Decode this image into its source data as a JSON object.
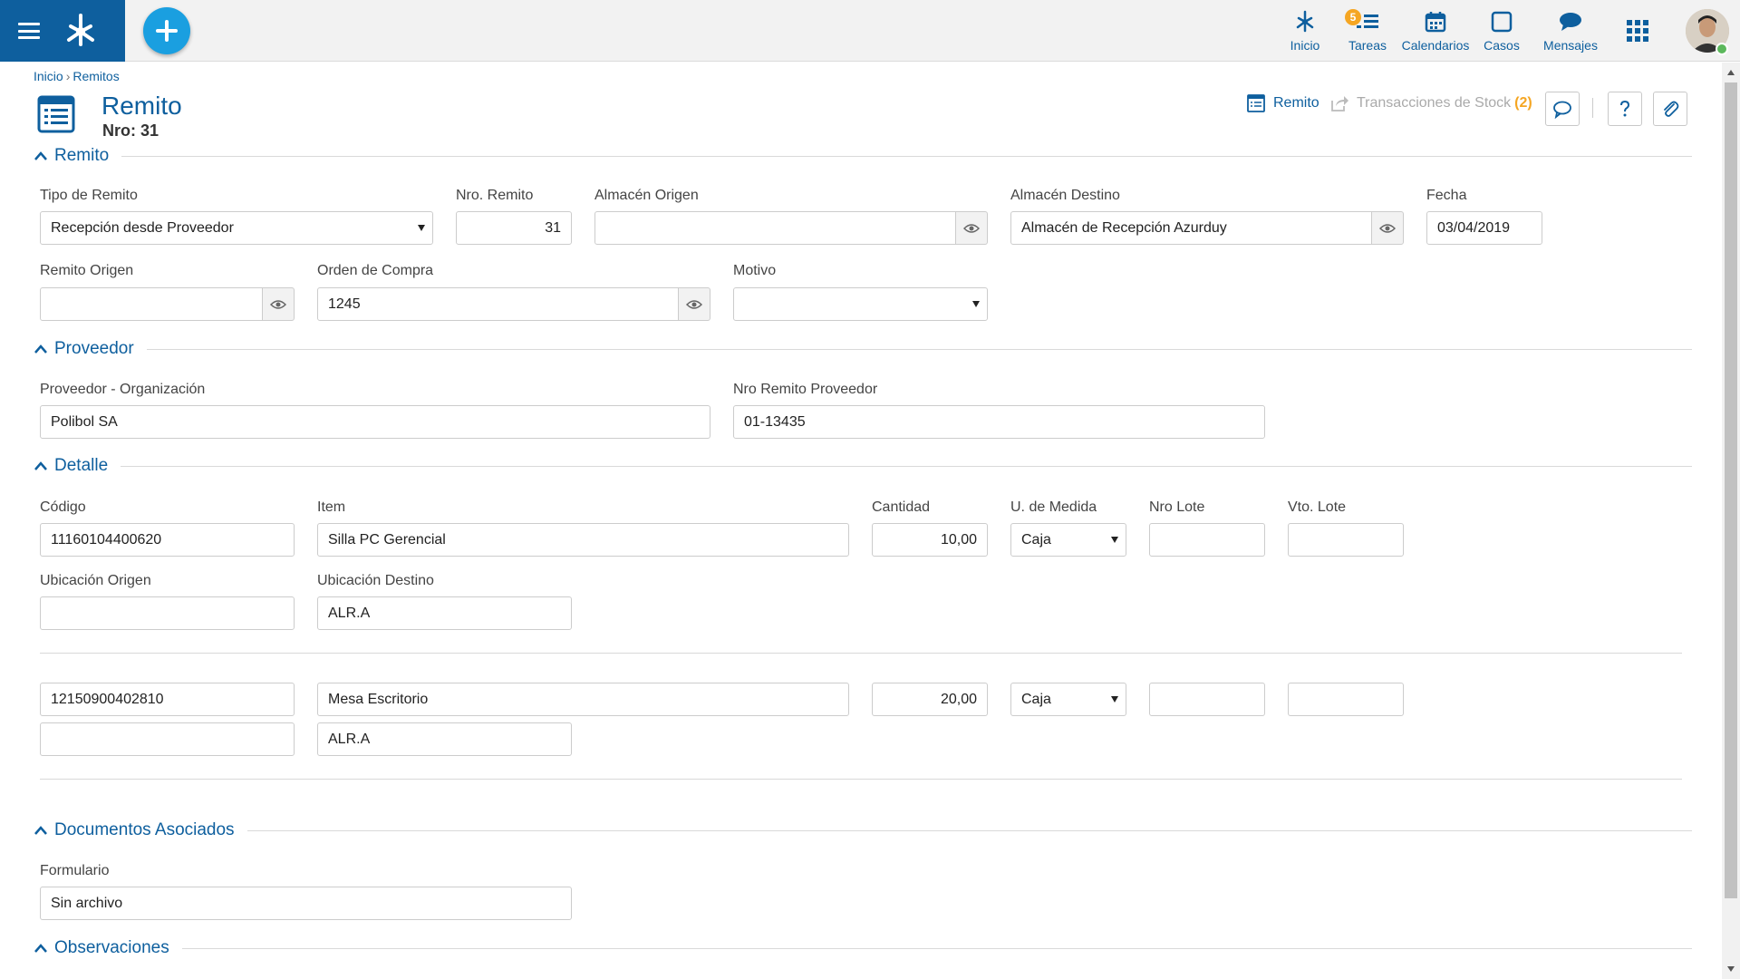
{
  "topbar": {
    "nav": [
      {
        "label": "Inicio",
        "icon": "home-tree-icon"
      },
      {
        "label": "Tareas",
        "icon": "tasks-icon",
        "badge": "5"
      },
      {
        "label": "Calendarios",
        "icon": "calendar-icon"
      },
      {
        "label": "Casos",
        "icon": "cases-icon"
      },
      {
        "label": "Mensajes",
        "icon": "messages-icon"
      }
    ]
  },
  "breadcrumb": {
    "home": "Inicio",
    "sep": "›",
    "current": "Remitos"
  },
  "page": {
    "title": "Remito",
    "subtitle": "Nro: 31"
  },
  "toolbar": {
    "remito_label": "Remito",
    "stock_label": "Transacciones de Stock",
    "stock_count": "(2)"
  },
  "sections": {
    "remito": "Remito",
    "proveedor": "Proveedor",
    "detalle": "Detalle",
    "documentos": "Documentos Asociados",
    "observaciones": "Observaciones"
  },
  "remito": {
    "tipo_label": "Tipo de Remito",
    "tipo_value": "Recepción desde Proveedor",
    "nro_label": "Nro. Remito",
    "nro_value": "31",
    "origen_label": "Almacén Origen",
    "origen_value": "",
    "destino_label": "Almacén Destino",
    "destino_value": "Almacén de Recepción Azurduy",
    "fecha_label": "Fecha",
    "fecha_value": "03/04/2019",
    "remito_origen_label": "Remito Origen",
    "remito_origen_value": "",
    "orden_label": "Orden de Compra",
    "orden_value": "1245",
    "motivo_label": "Motivo",
    "motivo_value": ""
  },
  "proveedor": {
    "org_label": "Proveedor - Organización",
    "org_value": "Polibol SA",
    "nro_label": "Nro Remito Proveedor",
    "nro_value": "01-13435"
  },
  "detalle": {
    "headers": {
      "codigo": "Código",
      "item": "Item",
      "cantidad": "Cantidad",
      "unidad": "U. de Medida",
      "lote": "Nro Lote",
      "vto": "Vto. Lote",
      "ub_origen": "Ubicación Origen",
      "ub_destino": "Ubicación Destino"
    },
    "rows": [
      {
        "codigo": "11160104400620",
        "item": "Silla PC Gerencial",
        "cantidad": "10,00",
        "unidad": "Caja",
        "lote": "",
        "vto": "",
        "ub_origen": "",
        "ub_destino": "ALR.A"
      },
      {
        "codigo": "12150900402810",
        "item": "Mesa Escritorio",
        "cantidad": "20,00",
        "unidad": "Caja",
        "lote": "",
        "vto": "",
        "ub_origen": "",
        "ub_destino": "ALR.A"
      }
    ]
  },
  "documentos": {
    "form_label": "Formulario",
    "form_value": "Sin archivo"
  },
  "colors": {
    "brand": "#0e5f9e",
    "fab": "#1a9fe0",
    "badge": "#f5a623"
  }
}
